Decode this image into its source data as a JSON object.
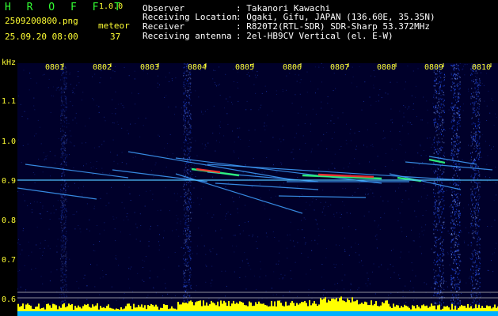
{
  "app": {
    "name": "H R O F F T",
    "version": "1.0.0"
  },
  "file": {
    "name": "2509200800.png",
    "datetime": "25.09.20 08:00"
  },
  "meteor": {
    "label": "meteor",
    "count": "37"
  },
  "station": [
    {
      "key": "Observer",
      "value": ": Takanori Kawachi"
    },
    {
      "key": "Receiving Location",
      "value": ": Ogaki, Gifu, JAPAN (136.60E, 35.35N)"
    },
    {
      "key": "Receiver",
      "value": ": R820T2(RTL-SDR) SDR-Sharp 53.372MHz"
    },
    {
      "key": "Receiving antenna",
      "value": ": 2el-HB9CV Vertical (el. E-W)"
    }
  ],
  "spectrogram": {
    "y_unit": "kHz",
    "y_ticks": [
      "1.1",
      "1.0",
      "0.9",
      "0.8",
      "0.7",
      "0.6"
    ],
    "x_labels": [
      "0801",
      "0802",
      "0803",
      "0804",
      "0805",
      "0806",
      "0807",
      "0808",
      "0809",
      "0810"
    ],
    "colors": {
      "signal_core": "#ff3030",
      "signal_mid": "#30ff80",
      "signal_low": "#40a0ff",
      "noise_band": "#2050ff",
      "level_bar": "#ffff00",
      "level_base": "#00b0ff"
    }
  }
}
